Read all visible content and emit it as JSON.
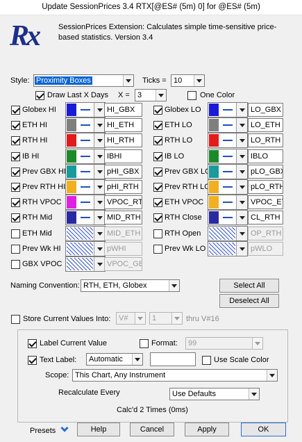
{
  "window": {
    "title": "Update SessionPrices 3.4 RTX[@ES# (5m) 0] for @ES# (5m)"
  },
  "header": {
    "logo_text": "Rx",
    "description": "SessionPrices Extension: Calculates simple time-sensitive price-based statistics. Version 3.4"
  },
  "style_row": {
    "style_label": "Style:",
    "style_value": "Proximity Boxes",
    "ticks_label": "Ticks =",
    "ticks_value": "10",
    "draw_last_label": "Draw Last X Days",
    "draw_last_checked": true,
    "x_label": "X =",
    "x_value": "3",
    "one_color_label": "One Color",
    "one_color_checked": false
  },
  "left_items": [
    {
      "label": "Globex HI",
      "checked": true,
      "color": "#1b1bd6",
      "value": "HI_GBX",
      "enabled": true
    },
    {
      "label": "ETH HI",
      "checked": true,
      "color": "#7f7f7f",
      "value": "HI_ETH",
      "enabled": true
    },
    {
      "label": "RTH HI",
      "checked": true,
      "color": "#e21b1b",
      "value": "HI_RTH",
      "enabled": true
    },
    {
      "label": "IB HI",
      "checked": true,
      "color": "#1a8a2a",
      "value": "IBHI",
      "enabled": true
    },
    {
      "label": "Prev GBX HI",
      "checked": true,
      "color": "#1a9a9a",
      "value": "pHI_GBX",
      "enabled": true
    },
    {
      "label": "Prev RTH HI",
      "checked": true,
      "color": "#f0b020",
      "value": "pHI_RTH",
      "enabled": true
    },
    {
      "label": "RTH VPOC",
      "checked": true,
      "color": "#e020e0",
      "value": "VPOC_RTH",
      "enabled": true
    },
    {
      "label": "RTH Mid",
      "checked": true,
      "color": "#2a2aa0",
      "value": "MID_RTH",
      "enabled": true
    },
    {
      "label": "ETH Mid",
      "checked": false,
      "color": "hatch",
      "value": "MID_ETH",
      "enabled": false
    },
    {
      "label": "Prev Wk HI",
      "checked": false,
      "color": "hatch",
      "value": "pWHI",
      "enabled": false
    },
    {
      "label": "GBX VPOC",
      "checked": false,
      "color": "hatch",
      "value": "VPOC_GBX",
      "enabled": false
    }
  ],
  "right_items": [
    {
      "label": "Globex LO",
      "checked": true,
      "color": "#1b1bd6",
      "value": "LO_GBX",
      "enabled": true
    },
    {
      "label": "ETH LO",
      "checked": true,
      "color": "#7f7f7f",
      "value": "LO_ETH",
      "enabled": true
    },
    {
      "label": "RTH LO",
      "checked": true,
      "color": "#e21b1b",
      "value": "LO_RTH",
      "enabled": true
    },
    {
      "label": "IB LO",
      "checked": true,
      "color": "#1a8a2a",
      "value": "IBLO",
      "enabled": true
    },
    {
      "label": "Prev GBX LO",
      "checked": true,
      "color": "#1a9a9a",
      "value": "pLO_GBX",
      "enabled": true
    },
    {
      "label": "Prev RTH LO",
      "checked": true,
      "color": "#f0b020",
      "value": "pLO_RTH",
      "enabled": true
    },
    {
      "label": "ETH VPOC",
      "checked": true,
      "color": "#f0b020",
      "value": "VPOC_ETH",
      "enabled": true
    },
    {
      "label": "RTH Close",
      "checked": true,
      "color": "#2a2aa0",
      "value": "CL_RTH",
      "enabled": true
    },
    {
      "label": "RTH Open",
      "checked": false,
      "color": "hatch",
      "value": "OP_RTH",
      "enabled": false
    },
    {
      "label": "Prev Wk LO",
      "checked": false,
      "color": "hatch",
      "value": "pWLO",
      "enabled": false
    }
  ],
  "naming": {
    "label": "Naming Convention:",
    "value": "RTH, ETH, Globex",
    "select_all": "Select All",
    "deselect_all": "Deselect All"
  },
  "store": {
    "label": "Store Current Values Into:",
    "checked": false,
    "var_value": "V#",
    "index_value": "1",
    "thru_label": "thru V#16"
  },
  "group": {
    "label_current_value": "Label Current Value",
    "label_current_checked": true,
    "format_label": "Format:",
    "format_checked": false,
    "format_value": "99",
    "text_label": "Text Label:",
    "text_label_checked": true,
    "text_label_value": "Automatic",
    "text_label_extra": "",
    "use_scale_color": "Use Scale Color",
    "use_scale_color_checked": false,
    "scope_label": "Scope:",
    "scope_value": "This Chart, Any Instrument",
    "recalc_label": "Recalculate Every",
    "recalc_value": "Use Defaults",
    "calc_status": "Calc'd 2 Times (0ms)"
  },
  "footer": {
    "presets": "Presets",
    "help": "Help",
    "cancel": "Cancel",
    "apply": "Apply",
    "ok": "OK"
  }
}
